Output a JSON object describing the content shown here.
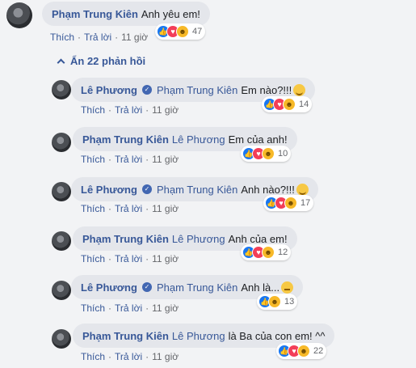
{
  "root_comment": {
    "author": "Phạm Trung Kiên",
    "text": "Anh yêu em!",
    "like": "Thích",
    "reply": "Trả lời",
    "time": "11 giờ",
    "reaction_count": "47",
    "reactions": [
      "like-icon",
      "love-icon",
      "haha-icon"
    ]
  },
  "toggle_label": "Ẩn 22 phản hồi",
  "replies": [
    {
      "author": "Lê Phương",
      "verified": true,
      "mention": "Phạm Trung Kiên",
      "text": "Em nào?!!!",
      "emoji": "grin-emoji",
      "like": "Thích",
      "reply": "Trả lời",
      "time": "11 giờ",
      "reaction_count": "14"
    },
    {
      "author": "Phạm Trung Kiên",
      "verified": false,
      "mention": "Lê Phương",
      "text": "Em của anh!",
      "emoji": "",
      "like": "Thích",
      "reply": "Trả lời",
      "time": "11 giờ",
      "reaction_count": "10"
    },
    {
      "author": "Lê Phương",
      "verified": true,
      "mention": "Phạm Trung Kiên",
      "text": "Anh nào?!!!",
      "emoji": "grin-emoji",
      "like": "Thích",
      "reply": "Trả lời",
      "time": "11 giờ",
      "reaction_count": "17"
    },
    {
      "author": "Phạm Trung Kiên",
      "verified": false,
      "mention": "Lê Phương",
      "text": "Anh của em!",
      "emoji": "",
      "like": "Thích",
      "reply": "Trả lời",
      "time": "11 giờ",
      "reaction_count": "12"
    },
    {
      "author": "Lê Phương",
      "verified": true,
      "mention": "Phạm Trung Kiên",
      "text": "Anh là...",
      "emoji": "eye-roll-emoji",
      "like": "Thích",
      "reply": "Trả lời",
      "time": "11 giờ",
      "reaction_count": "13"
    },
    {
      "author": "Phạm Trung Kiên",
      "verified": false,
      "mention": "Lê Phương",
      "text": "là Ba của con em! ^^",
      "emoji": "",
      "like": "Thích",
      "reply": "Trả lời",
      "time": "11 giờ",
      "reaction_count": "22"
    }
  ],
  "colors": {
    "link": "#385898",
    "bubble": "#e4e6eb",
    "like": "#1877f2",
    "love": "#f33e58",
    "haha": "#f7b928"
  }
}
